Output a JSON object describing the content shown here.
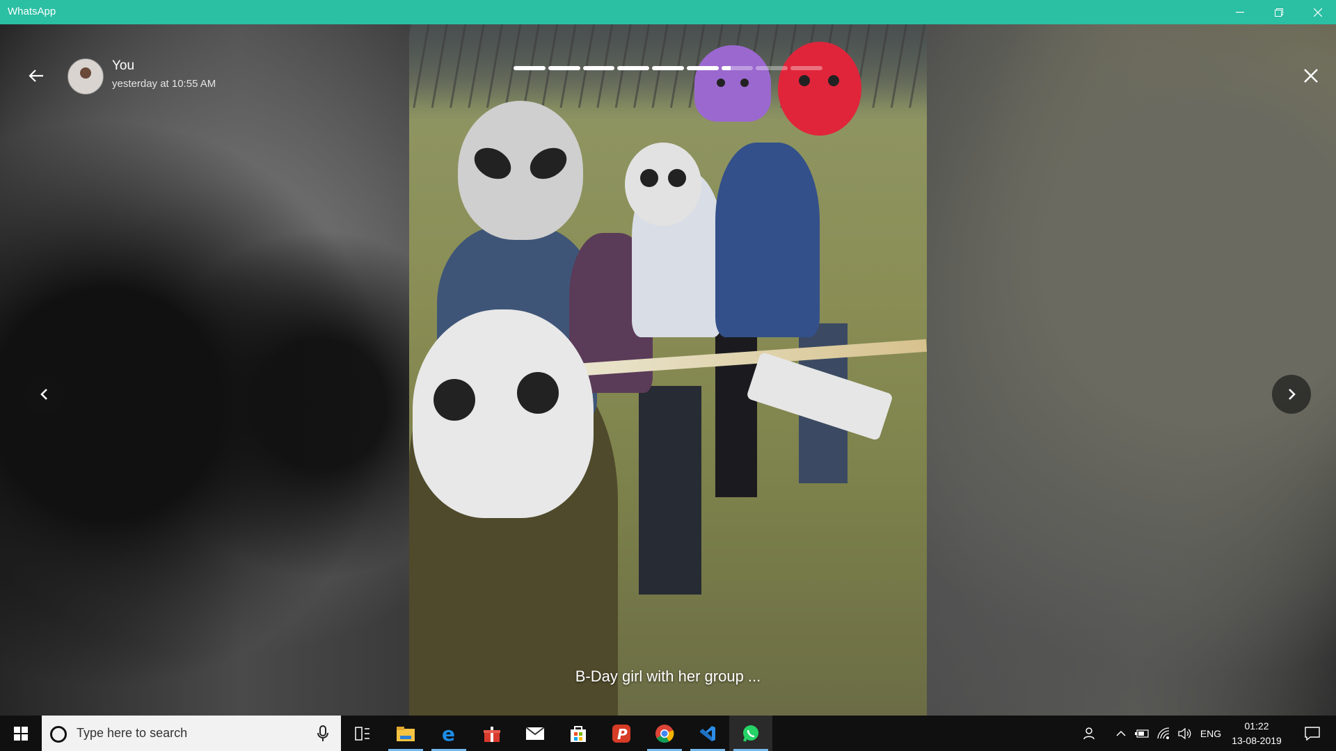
{
  "window": {
    "title": "WhatsApp",
    "controls": [
      "minimize-icon",
      "restore-icon",
      "close-icon"
    ]
  },
  "status_viewer": {
    "contact_name": "You",
    "timestamp": "yesterday at 10:55 AM",
    "caption": "B-Day girl with her group ...",
    "progress_segments": [
      1,
      1,
      1,
      1,
      1,
      1,
      0.3,
      0,
      0
    ],
    "icons": {
      "back": "arrow-left-icon",
      "close": "close-icon",
      "prev": "chevron-left-icon",
      "next": "chevron-right-icon"
    }
  },
  "taskbar": {
    "search_placeholder": "Type here to search",
    "apps": [
      "task-view-icon",
      "file-explorer-icon",
      "edge-icon",
      "gift-icon",
      "mail-icon",
      "store-icon",
      "p-app-icon",
      "chrome-icon",
      "vscode-icon",
      "whatsapp-icon"
    ],
    "language": "ENG",
    "time": "01:22",
    "date": "13-08-2019"
  },
  "colors": {
    "titlebar": "#2bbfa4",
    "taskbar": "#101010",
    "taskbar_accent": "#76b9ed"
  }
}
